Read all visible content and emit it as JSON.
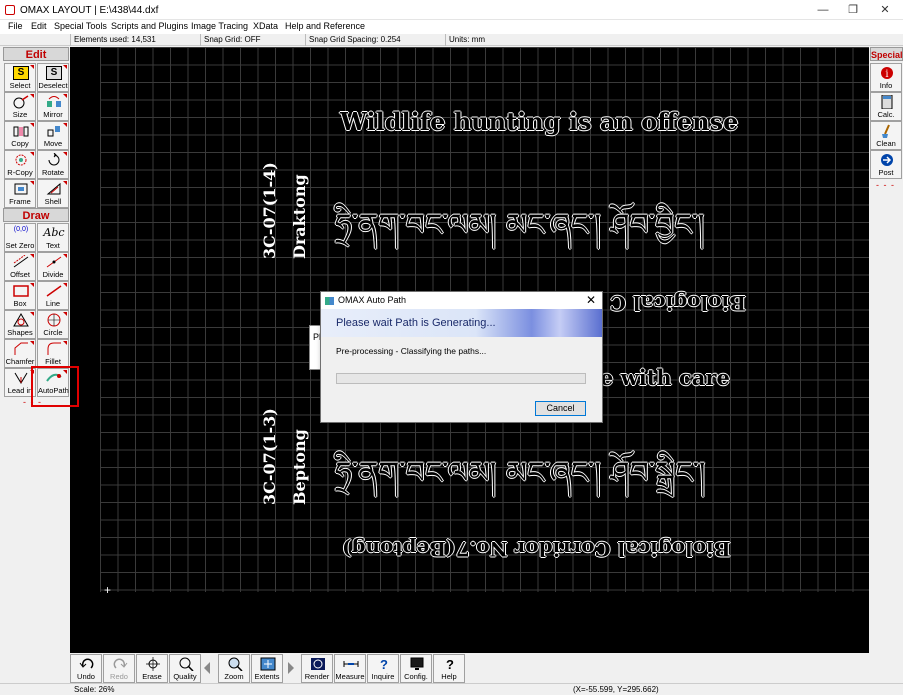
{
  "window": {
    "title": "OMAX LAYOUT | E:\\438\\44.dxf"
  },
  "menu": [
    "File",
    "Edit",
    "Special Tools",
    "Scripts and Plugins",
    "Image Tracing",
    "XData",
    "Help and Reference"
  ],
  "status_top": {
    "elements": "Elements used: 14,531",
    "snap_grid": "Snap Grid: OFF",
    "snap_spacing": "Snap Grid Spacing: 0.254",
    "units": "Units: mm"
  },
  "left_panel": {
    "edit_header": "Edit",
    "draw_header": "Draw",
    "edit_tools": [
      "Select",
      "Deselect",
      "Size",
      "Mirror",
      "Copy",
      "Move",
      "R-Copy",
      "Rotate",
      "Frame",
      "Shell"
    ],
    "draw_tools": [
      "Set Zero",
      "Text",
      "Offset",
      "Divide",
      "Box",
      "Line",
      "Shapes",
      "Circle",
      "Chamfer",
      "Fillet",
      "Lead in",
      "AutoPath"
    ],
    "dashes": "- - -"
  },
  "right_panel": {
    "header": "Special",
    "tools": [
      "Info",
      "Calc.",
      "Clean",
      "Post"
    ],
    "dashes": "- - -"
  },
  "canvas": {
    "line1": "Wildlife hunting is an offense",
    "line2_rotated_left": "3C-07(1-4)",
    "line2_rotated_right": "Draktong",
    "tibetan1": "ཧྲི་ནག་བང་ལམ། མང་ཞང་། ཤོབ་བྱིང་།",
    "mirrored1": "Biological C",
    "line3": "e with care",
    "line4_rotated_left": "3C-07(1-3)",
    "line4_rotated_right": "Beptong",
    "tibetan2": "ཧྲི་ནག་བང་ལམ། མང་ཞང་། ཤོབ་སྒྲིང་།",
    "mirrored2": "Biological Corridor No.7(Beptong)"
  },
  "bg_dialog_text": "Ple",
  "dialog": {
    "title": "OMAX Auto Path",
    "banner": "Please wait Path is Generating...",
    "message": "Pre-processing - Classifying the paths...",
    "progress": 0,
    "cancel": "Cancel"
  },
  "bottom_toolbar": [
    "Undo",
    "Redo",
    "Erase",
    "Quality",
    "Zoom",
    "Extents",
    "Render",
    "Measure",
    "Inquire",
    "Config.",
    "Help"
  ],
  "status_bottom": {
    "scale": "Scale: 26%",
    "coords": "(X=-55.599, Y=295.662)"
  }
}
